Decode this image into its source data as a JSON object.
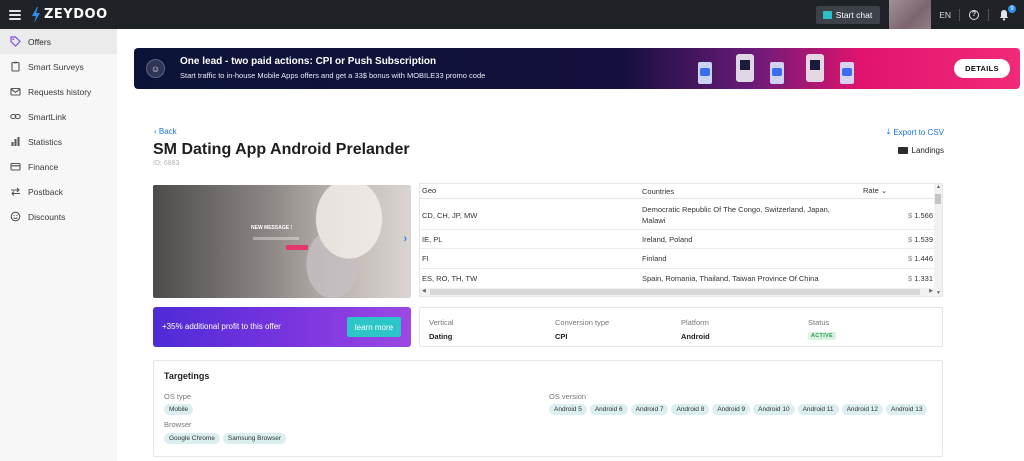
{
  "topbar": {
    "logo": "ZEYDOO",
    "start_chat": "Start chat",
    "lang": "EN",
    "notif_count": "9"
  },
  "sidebar": {
    "items": [
      {
        "label": "Offers",
        "icon": "tag-icon",
        "active": true
      },
      {
        "label": "Smart Surveys",
        "icon": "clipboard-icon"
      },
      {
        "label": "Requests history",
        "icon": "mail-icon"
      },
      {
        "label": "SmartLink",
        "icon": "link-icon"
      },
      {
        "label": "Statistics",
        "icon": "bar-chart-icon"
      },
      {
        "label": "Finance",
        "icon": "wallet-icon"
      },
      {
        "label": "Postback",
        "icon": "swap-icon"
      },
      {
        "label": "Discounts",
        "icon": "smile-icon"
      }
    ]
  },
  "banner": {
    "title": "One lead - two paid actions: CPI or Push Subscription",
    "subtitle": "Start traffic to in-house Mobile Apps offers and get a 33$ bonus with MOBILE33 promo code",
    "button": "DETAILS"
  },
  "offer": {
    "back": "Back",
    "export": "Export to CSV",
    "title": "SM Dating App Android Prelander",
    "id": "ID: 6883",
    "landings": "Landings"
  },
  "preview": {
    "message": "NEW MESSAGE !"
  },
  "geo_table": {
    "headers": {
      "geo": "Geo",
      "countries": "Countries",
      "rate": "Rate"
    },
    "rows": [
      {
        "geo": "CD, CH, JP, MW",
        "countries": "Democratic Republic Of The Congo, Switzerland, Japan, Malawi",
        "currency": "$",
        "rate": "1.566"
      },
      {
        "geo": "IE, PL",
        "countries": "Ireland, Poland",
        "currency": "$",
        "rate": "1.539"
      },
      {
        "geo": "FI",
        "countries": "Finland",
        "currency": "$",
        "rate": "1.446"
      },
      {
        "geo": "ES, RO, TH, TW",
        "countries": "Spain, Romania, Thailand, Taiwan Province Of China",
        "currency": "$",
        "rate": "1.331"
      }
    ]
  },
  "promo": {
    "text": "+35% additional profit to this offer",
    "button": "learn more"
  },
  "info": {
    "vertical_label": "Vertical",
    "vertical": "Dating",
    "conversion_label": "Conversion type",
    "conversion": "CPI",
    "platform_label": "Platform",
    "platform": "Android",
    "status_label": "Status",
    "status": "ACTIVE"
  },
  "targetings": {
    "title": "Targetings",
    "os_type_label": "OS type",
    "os_type": [
      "Mobile"
    ],
    "browser_label": "Browser",
    "browsers": [
      "Google Chrome",
      "Samsung Browser"
    ],
    "os_version_label": "OS version",
    "os_versions": [
      "Android 5",
      "Android 6",
      "Android 7",
      "Android 8",
      "Android 9",
      "Android 10",
      "Android 11",
      "Android 12",
      "Android 13"
    ]
  },
  "colors": {
    "accent": "#1a73d9",
    "teal": "#2cc5c8",
    "promo": "#6a2fdc",
    "topbar": "#1f2327"
  }
}
